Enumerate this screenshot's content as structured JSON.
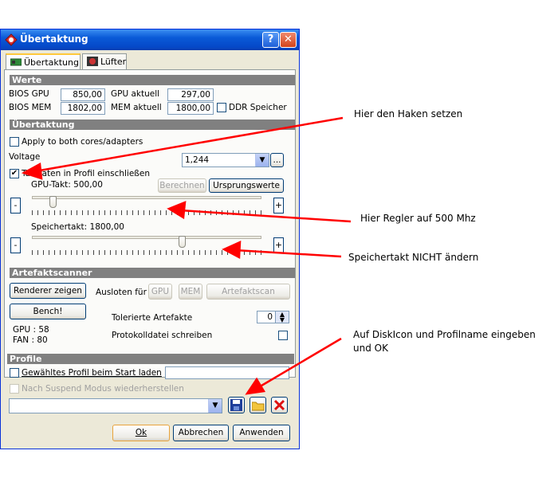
{
  "window": {
    "title": "Übertaktung",
    "help": "?",
    "close": "✕"
  },
  "tabs": [
    {
      "label": "Übertaktung"
    },
    {
      "label": "Lüfter"
    }
  ],
  "werte": {
    "header": "Werte",
    "bios_gpu_label": "BIOS GPU",
    "bios_gpu": "850,00",
    "gpu_aktuell_label": "GPU aktuell",
    "gpu_aktuell": "297,00",
    "bios_mem_label": "BIOS MEM",
    "bios_mem": "1802,00",
    "mem_aktuell_label": "MEM aktuell",
    "mem_aktuell": "1800,00",
    "ddr_label": "DDR Speicher"
  },
  "uebertaktung": {
    "header": "Übertaktung",
    "apply_both": "Apply to both cores/adapters",
    "voltage_label": "Voltage",
    "voltage_value": "1,244",
    "ellipsis": "...",
    "taktraten": "Taktraten in Profil einschließen",
    "taktraten_checked": true,
    "gpu_takt": "GPU-Takt: 500,00",
    "berechnen": "Berechnen",
    "ursprung": "Ursprungswerte",
    "speichertakt": "Speichertakt: 1800,00",
    "minus": "-",
    "plus": "+",
    "gpu_slider_level": 0.08,
    "mem_slider_level": 0.66
  },
  "artefakt": {
    "header": "Artefaktscanner",
    "renderer": "Renderer zeigen",
    "bench": "Bench!",
    "ausloten": "Ausloten für",
    "gpu_btn": "GPU",
    "mem_btn": "MEM",
    "scan_btn": "Artefaktscan",
    "toleriert": "Tolerierte Artefakte",
    "toleriert_value": "0",
    "protokoll": "Protokolldatei schreiben",
    "gpu_stat": "GPU : 58",
    "fan_stat": "FAN : 80"
  },
  "profile": {
    "header": "Profile",
    "start": "Gewähltes Profil beim Start laden",
    "suspend": "Nach Suspend Modus wiederherstellen"
  },
  "footer": {
    "ok": "Ok",
    "cancel": "Abbrechen",
    "apply": "Anwenden"
  },
  "annotations": {
    "haken": "Hier den Haken setzen",
    "regler": "Hier Regler auf 500 Mhz",
    "speicher": "Speichertakt NICHT ändern",
    "disk_line1": "Auf DiskIcon und Profilname eingeben",
    "disk_line2": "und OK"
  },
  "colors": {
    "arrow": "#ff0000",
    "titlebar": "#0a5ad7",
    "section": "#808080"
  }
}
